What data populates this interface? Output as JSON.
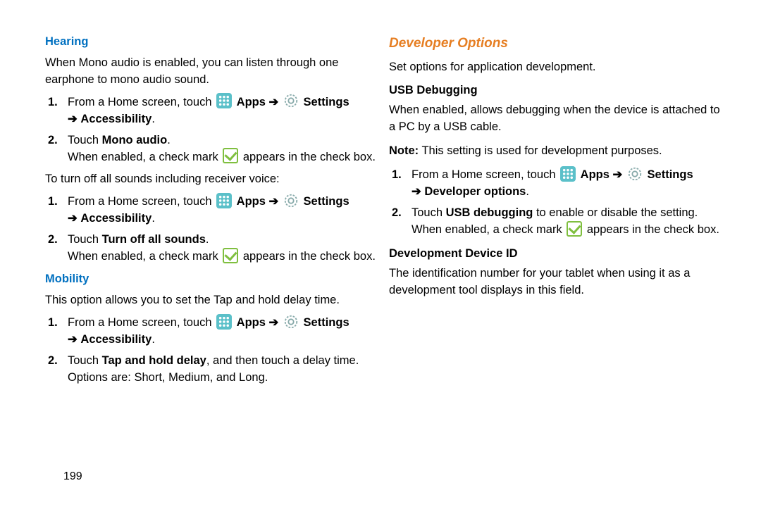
{
  "left": {
    "hearing": {
      "title": "Hearing",
      "intro": "When Mono audio is enabled, you can listen through one earphone to mono audio sound.",
      "step1_pre": "From a Home screen, touch ",
      "apps": "Apps",
      "settings": "Settings",
      "accessibility": "Accessibility",
      "step2_pre": "Touch ",
      "step2_bold": "Mono audio",
      "step2_tail": ".",
      "check_pre": "When enabled, a check mark ",
      "check_post": " appears in the check box.",
      "turnoff_intro": "To turn off all sounds including receiver voice:",
      "step2b_pre": "Touch ",
      "step2b_bold": "Turn off all sounds",
      "step2b_tail": "."
    },
    "mobility": {
      "title": "Mobility",
      "intro": "This option allows you to set the Tap and hold delay time.",
      "step1_pre": "From a Home screen, touch ",
      "step2_pre": "Touch ",
      "step2_bold": "Tap and hold delay",
      "step2_mid": ", and then touch a delay time.",
      "step2_next": "Options are: Short, Medium, and Long."
    }
  },
  "right": {
    "title": "Developer Options",
    "intro": "Set options for application development.",
    "usb": {
      "title": "USB Debugging",
      "desc": "When enabled, allows debugging when the device is attached to a PC by a USB cable.",
      "note_label": "Note:",
      "note_text": " This setting is used for development purposes.",
      "step1_pre": "From a Home screen, touch ",
      "apps": "Apps",
      "settings": "Settings",
      "devopts": "Developer options",
      "step2_pre": "Touch ",
      "step2_bold": "USB debugging",
      "step2_tail": " to enable or disable the setting.",
      "check_pre": "When enabled, a check mark ",
      "check_post": " appears in the check box."
    },
    "devid": {
      "title": "Development Device ID",
      "desc": "The identification number for your tablet when using it as a development tool displays in this field."
    }
  },
  "pagenum": "199",
  "arrow": "➔"
}
